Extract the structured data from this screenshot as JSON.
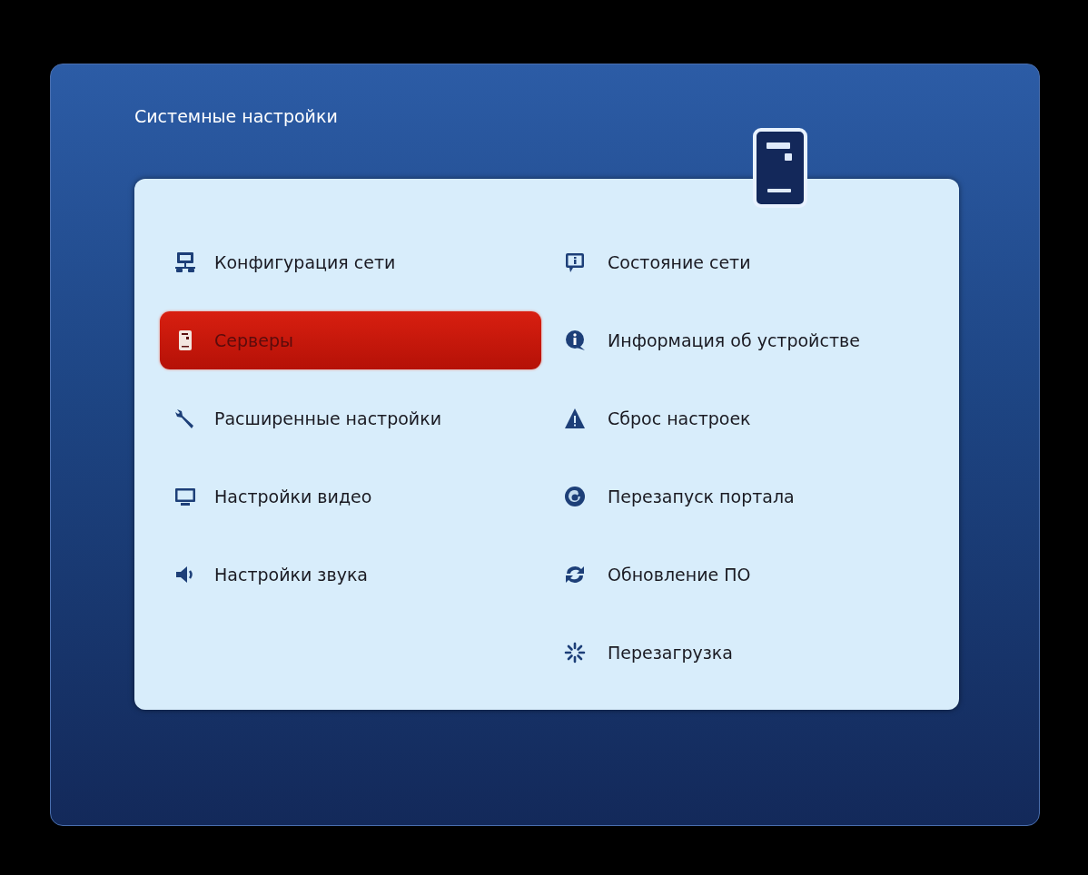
{
  "title": "Системные настройки",
  "columns": [
    {
      "items": [
        {
          "label": "Конфигурация сети",
          "kind": "network",
          "selected": false
        },
        {
          "label": "Серверы",
          "kind": "server",
          "selected": true
        },
        {
          "label": "Расширенные настройки",
          "kind": "wrench",
          "selected": false
        },
        {
          "label": "Настройки видео",
          "kind": "monitor",
          "selected": false
        },
        {
          "label": "Настройки звука",
          "kind": "speaker",
          "selected": false
        }
      ]
    },
    {
      "items": [
        {
          "label": "Состояние сети",
          "kind": "info-screen",
          "selected": false
        },
        {
          "label": "Информация об устройстве",
          "kind": "info-bubble",
          "selected": false
        },
        {
          "label": "Сброс настроек",
          "kind": "warning",
          "selected": false
        },
        {
          "label": "Перезапуск портала",
          "kind": "reload",
          "selected": false
        },
        {
          "label": "Обновление ПО",
          "kind": "sync",
          "selected": false
        },
        {
          "label": "Перезагрузка",
          "kind": "spinner",
          "selected": false
        }
      ]
    }
  ]
}
